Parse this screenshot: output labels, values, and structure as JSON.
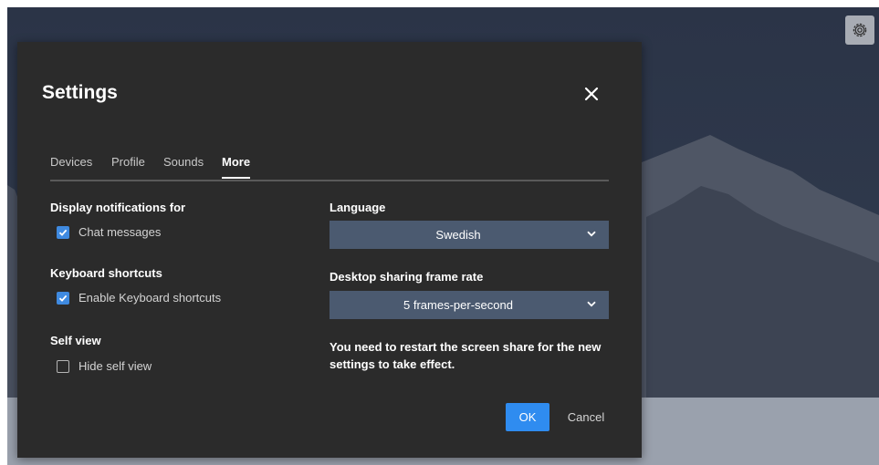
{
  "dialog": {
    "title": "Settings",
    "close_icon": "close-icon",
    "tabs": [
      {
        "label": "Devices",
        "active": false
      },
      {
        "label": "Profile",
        "active": false
      },
      {
        "label": "Sounds",
        "active": false
      },
      {
        "label": "More",
        "active": true
      }
    ],
    "left": {
      "notifications": {
        "heading": "Display notifications for",
        "options": [
          {
            "label": "Chat messages",
            "checked": true
          }
        ]
      },
      "shortcuts": {
        "heading": "Keyboard shortcuts",
        "options": [
          {
            "label": "Enable Keyboard shortcuts",
            "checked": true
          }
        ]
      },
      "self_view": {
        "heading": "Self view",
        "options": [
          {
            "label": "Hide self view",
            "checked": false
          }
        ]
      }
    },
    "right": {
      "language": {
        "heading": "Language",
        "value": "Swedish"
      },
      "frame_rate": {
        "heading": "Desktop sharing frame rate",
        "value": "5 frames-per-second"
      },
      "note": "You need to restart the screen share for the new settings to take effect."
    },
    "buttons": {
      "ok": "OK",
      "cancel": "Cancel"
    }
  },
  "toolbar": {
    "settings_icon": "gear-icon"
  },
  "colors": {
    "dialog_bg": "#2b2b2b",
    "accent": "#2f8cf0",
    "select_bg": "#4b5a70",
    "checkbox_on": "#3f8ae0"
  }
}
